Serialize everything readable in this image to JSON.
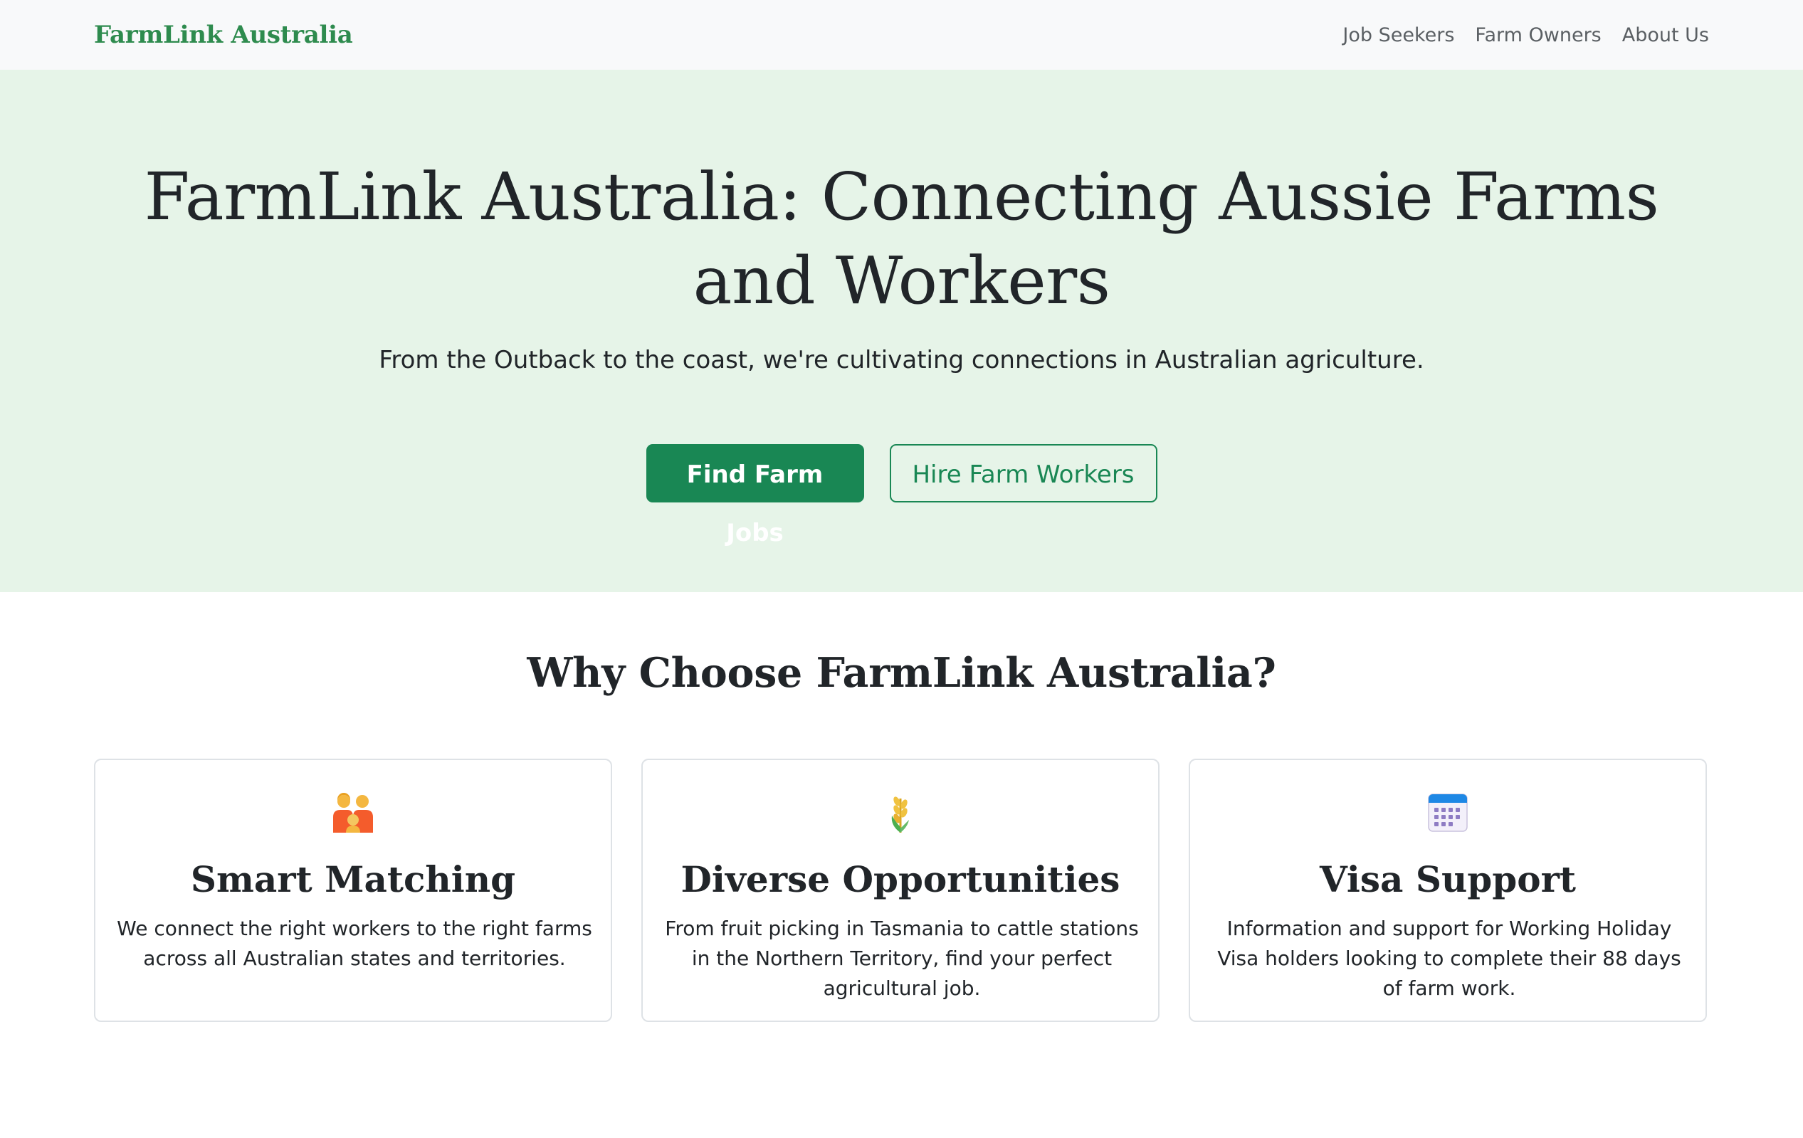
{
  "navbar": {
    "brand": "FarmLink Australia",
    "links": [
      "Job Seekers",
      "Farm Owners",
      "About Us"
    ]
  },
  "hero": {
    "title": "FarmLink Australia: Connecting Aussie Farms and Workers",
    "subtitle": "From the Outback to the coast, we're cultivating connections in Australian agriculture.",
    "primary_button": "Find Farm Jobs",
    "secondary_button": "Hire Farm Workers"
  },
  "features": {
    "title": "Why Choose FarmLink Australia?",
    "cards": [
      {
        "icon": "family-icon",
        "title": "Smart Matching",
        "text": "We connect the right workers to the right farms across all Australian states and territories."
      },
      {
        "icon": "wheat-icon",
        "title": "Diverse Opportunities",
        "text": "From fruit picking in Tasmania to cattle stations in the Northern Territory, find your perfect agricultural job."
      },
      {
        "icon": "calendar-icon",
        "title": "Visa Support",
        "text": "Information and support for Working Holiday Visa holders looking to complete their 88 days of farm work."
      }
    ]
  },
  "colors": {
    "brand": "#2e8b4e",
    "accent": "#198754",
    "hero_bg": "#e6f4e8",
    "navbar_bg": "#f8f9fa"
  }
}
